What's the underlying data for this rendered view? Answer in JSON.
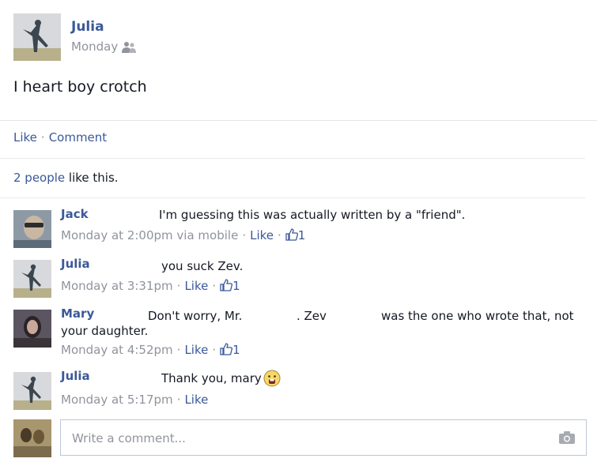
{
  "post": {
    "author": "Julia",
    "date": "Monday",
    "audience_icon": "friends-icon",
    "text": "I heart boy crotch"
  },
  "actions": {
    "like": "Like",
    "comment": "Comment"
  },
  "likes": {
    "count_link": "2 people",
    "suffix": " like this."
  },
  "comments": [
    {
      "name": "Jack",
      "text": "I'm guessing this was actually written by a \"friend\".",
      "time": "Monday at 2:00pm",
      "via": " via mobile",
      "like": "Like",
      "likes": "1"
    },
    {
      "name": "Julia",
      "text": "you suck Zev.",
      "time": "Monday at 3:31pm",
      "like": "Like",
      "likes": "1"
    },
    {
      "name": "Mary",
      "text_a": "Don't worry, Mr.",
      "text_b": ". Zev",
      "text_c": "was the one who wrote that, not",
      "text_d": "your daughter.",
      "time": "Monday at 4:52pm",
      "like": "Like",
      "likes": "1"
    },
    {
      "name": "Julia",
      "text": "Thank you, mary",
      "time": "Monday at 5:17pm",
      "like": "Like"
    }
  ],
  "composer": {
    "placeholder": "Write a comment..."
  },
  "colors": {
    "link": "#3b5998",
    "meta": "#90949c",
    "text": "#141823"
  }
}
